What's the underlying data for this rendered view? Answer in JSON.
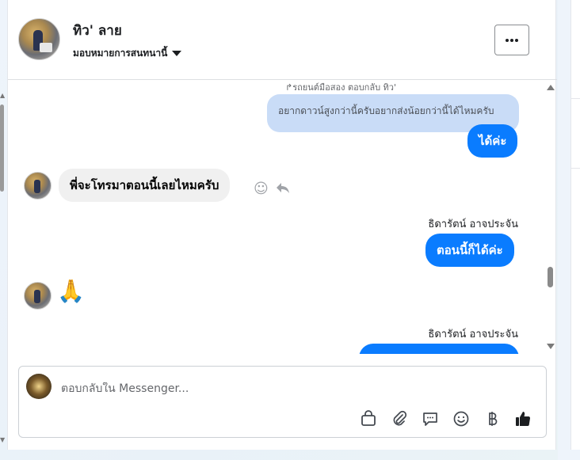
{
  "header": {
    "contact_name": "ทิว' ลาย",
    "assign_label": "มอบหมายการสนทนานี้"
  },
  "conversation": {
    "reply_note": "↱รถยนต์มือสอง ตอบกลับ ทิว'",
    "quoted_message": "อยากดาวน์สูงกว่านี้ครับอยากส่งน้อยกว่านี้ได้ไหมครับ",
    "messages": [
      {
        "direction": "out",
        "text": "ได้ค่ะ"
      },
      {
        "direction": "in",
        "text": "พี่จะโทรมาตอนนี้เลยไหมครับ"
      },
      {
        "direction": "out",
        "sender": "ธิดารัตน์ อาจประจัน",
        "text": "ตอนนี้ก็ได้ค่ะ"
      },
      {
        "direction": "in",
        "text": "🙏"
      },
      {
        "direction": "out",
        "sender": "ธิดารัตน์ อาจประจัน",
        "text": ""
      }
    ]
  },
  "composer": {
    "placeholder": "ตอบกลับใน Messenger..."
  },
  "icons": {
    "toolbar": [
      "shopping-bag-icon",
      "paperclip-icon",
      "saved-reply-icon",
      "emoji-icon",
      "baht-icon",
      "like-icon"
    ],
    "message_actions": [
      "react-icon",
      "reply-icon"
    ]
  },
  "colors": {
    "outgoing_bubble": "#0a7cff",
    "quoted_bubble": "#c9dcf7",
    "incoming_bubble": "#f0f0f0",
    "like": "#1c1e21"
  }
}
